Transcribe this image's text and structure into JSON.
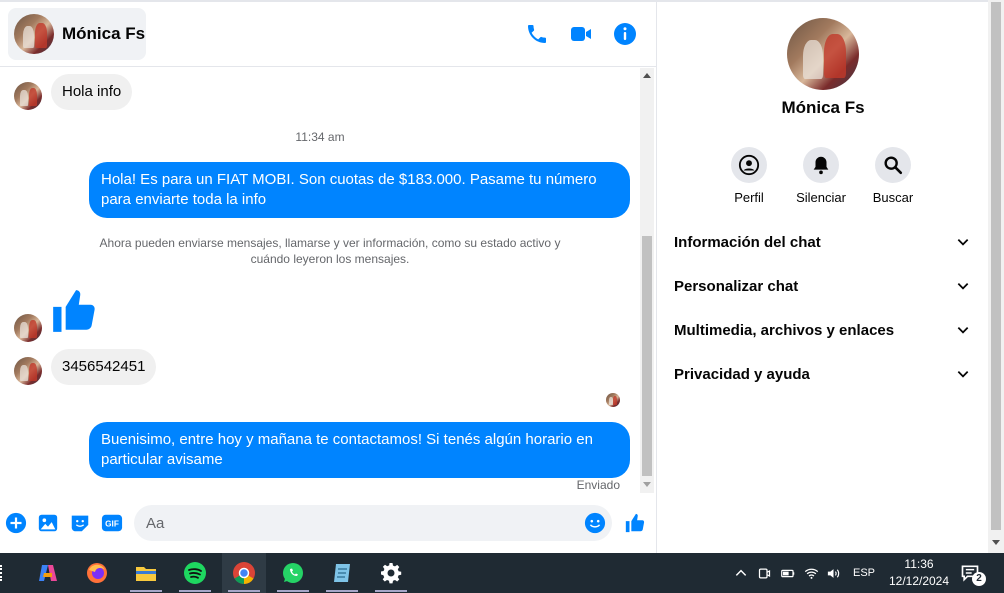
{
  "header": {
    "contact_name": "Mónica Fs",
    "icons": [
      "phone-icon",
      "video-camera-icon",
      "info-icon"
    ]
  },
  "messages": {
    "incoming_1": "Hola info",
    "timestamp_1": "11:34 am",
    "outgoing_1": "Hola! Es para un FIAT MOBI. Son cuotas de $183.000. Pasame tu número para enviarte toda la info",
    "system_note": "Ahora pueden enviarse mensajes, llamarse y ver información, como su estado activo y cuándo leyeron los mensajes.",
    "incoming_2": "3456542451",
    "outgoing_2": "Buenisimo, entre hoy y mañana te contactamos! Si tenés algún horario en particular avisame",
    "status": "Enviado"
  },
  "composer": {
    "placeholder": "Aa",
    "icons": [
      "plus-icon",
      "image-icon",
      "sticker-icon",
      "gif-icon",
      "emoji-icon",
      "thumbs-up-icon"
    ],
    "gif_label": "GIF"
  },
  "info_panel": {
    "name": "Mónica Fs",
    "actions": [
      {
        "label": "Perfil",
        "icon": "profile-icon"
      },
      {
        "label": "Silenciar",
        "icon": "bell-icon"
      },
      {
        "label": "Buscar",
        "icon": "search-icon"
      }
    ],
    "sections": [
      {
        "label": "Información del chat"
      },
      {
        "label": "Personalizar chat"
      },
      {
        "label": "Multimedia, archivos y enlaces"
      },
      {
        "label": "Privacidad y ayuda"
      }
    ]
  },
  "taskbar": {
    "apps": [
      "copilot-icon",
      "firefox-icon",
      "file-explorer-icon",
      "spotify-icon",
      "chrome-icon",
      "whatsapp-icon",
      "notepad-icon",
      "settings-icon"
    ],
    "language": "ESP",
    "time": "11:36",
    "date": "12/12/2024",
    "notifications": "2"
  },
  "colors": {
    "accent": "#0084ff",
    "outgoing_bubble": "#0084ff",
    "incoming_bubble": "#f0f0f0",
    "taskbar": "#1f2a33"
  }
}
